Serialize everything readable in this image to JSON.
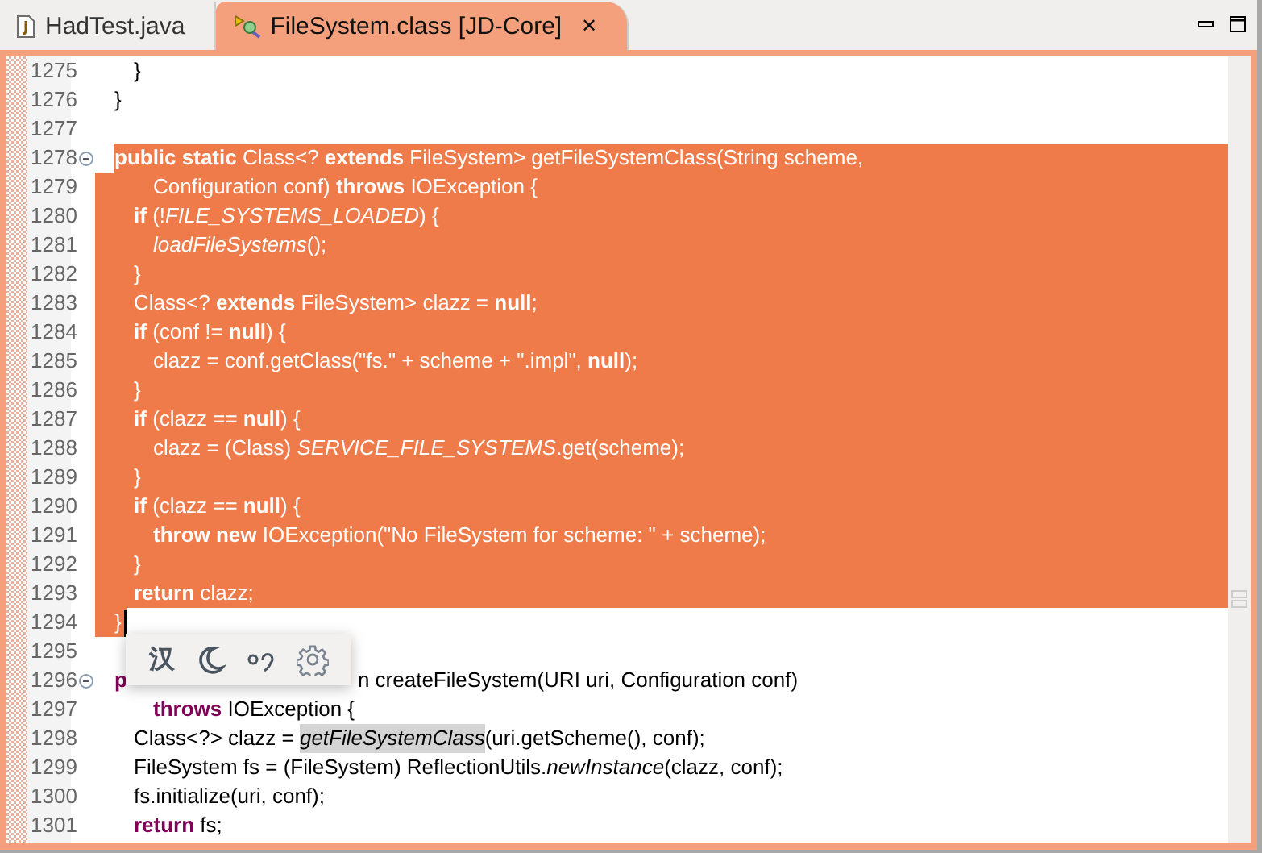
{
  "tabs": [
    {
      "label": "HadTest.java",
      "kind": "java",
      "selected": false
    },
    {
      "label": "FileSystem.class [JD-Core]",
      "kind": "class",
      "selected": true,
      "close": "✕"
    }
  ],
  "editor": {
    "lines": [
      {
        "number": "1275",
        "selected": false,
        "tokens": [
          {
            "text": "\t}",
            "kind": "plain"
          }
        ]
      },
      {
        "number": "1276",
        "selected": false,
        "tokens": [
          {
            "text": "}",
            "kind": "plain"
          }
        ]
      },
      {
        "number": "1277",
        "selected": false
      },
      {
        "number": "1278",
        "selected": true,
        "fold": true,
        "tokens": [
          {
            "text": "public static",
            "kind": "keyword"
          },
          {
            "text": " Class<? ",
            "kind": "plain"
          },
          {
            "text": "extends",
            "kind": "keyword"
          },
          {
            "text": " FileSystem> getFileSystemClass(String scheme,",
            "kind": "plain"
          }
        ]
      },
      {
        "number": "1279",
        "selected": true,
        "tokens": [
          {
            "text": "\t\tConfiguration conf) ",
            "kind": "plain"
          },
          {
            "text": "throws",
            "kind": "keyword"
          },
          {
            "text": " IOException {",
            "kind": "plain"
          }
        ]
      },
      {
        "number": "1280",
        "selected": true,
        "tokens": [
          {
            "text": "\tif",
            "kind": "keyword"
          },
          {
            "text": " (!",
            "kind": "plain"
          },
          {
            "text": "FILE_SYSTEMS_LOADED",
            "kind": "constant"
          },
          {
            "text": ") {",
            "kind": "plain"
          }
        ]
      },
      {
        "number": "1281",
        "selected": true,
        "tokens": [
          {
            "text": "\t\tloadFileSystems",
            "kind": "italic"
          },
          {
            "text": "();",
            "kind": "plain"
          }
        ]
      },
      {
        "number": "1282",
        "selected": true,
        "tokens": [
          {
            "text": "\t}",
            "kind": "plain"
          }
        ]
      },
      {
        "number": "1283",
        "selected": true,
        "tokens": [
          {
            "text": "\tClass<? ",
            "kind": "plain"
          },
          {
            "text": "extends",
            "kind": "keyword"
          },
          {
            "text": " FileSystem> clazz = ",
            "kind": "plain"
          },
          {
            "text": "null",
            "kind": "keyword"
          },
          {
            "text": ";",
            "kind": "plain"
          }
        ]
      },
      {
        "number": "1284",
        "selected": true,
        "tokens": [
          {
            "text": "\tif",
            "kind": "keyword"
          },
          {
            "text": " (conf != ",
            "kind": "plain"
          },
          {
            "text": "null",
            "kind": "keyword"
          },
          {
            "text": ") {",
            "kind": "plain"
          }
        ]
      },
      {
        "number": "1285",
        "selected": true,
        "tokens": [
          {
            "text": "\t\tclazz = conf.getClass(\"fs.\" + scheme + \".impl\", ",
            "kind": "plain"
          },
          {
            "text": "null",
            "kind": "keyword"
          },
          {
            "text": ");",
            "kind": "plain"
          }
        ]
      },
      {
        "number": "1286",
        "selected": true,
        "tokens": [
          {
            "text": "\t}",
            "kind": "plain"
          }
        ]
      },
      {
        "number": "1287",
        "selected": true,
        "tokens": [
          {
            "text": "\tif",
            "kind": "keyword"
          },
          {
            "text": " (clazz == ",
            "kind": "plain"
          },
          {
            "text": "null",
            "kind": "keyword"
          },
          {
            "text": ") {",
            "kind": "plain"
          }
        ]
      },
      {
        "number": "1288",
        "selected": true,
        "tokens": [
          {
            "text": "\t\tclazz = (Class) ",
            "kind": "plain"
          },
          {
            "text": "SERVICE_FILE_SYSTEMS",
            "kind": "constant"
          },
          {
            "text": ".get(scheme);",
            "kind": "plain"
          }
        ]
      },
      {
        "number": "1289",
        "selected": true,
        "tokens": [
          {
            "text": "\t}",
            "kind": "plain"
          }
        ]
      },
      {
        "number": "1290",
        "selected": true,
        "tokens": [
          {
            "text": "\tif",
            "kind": "keyword"
          },
          {
            "text": " (clazz == ",
            "kind": "plain"
          },
          {
            "text": "null",
            "kind": "keyword"
          },
          {
            "text": ") {",
            "kind": "plain"
          }
        ]
      },
      {
        "number": "1291",
        "selected": true,
        "tokens": [
          {
            "text": "\t\tthrow new",
            "kind": "keyword"
          },
          {
            "text": " IOException(\"No FileSystem for scheme: \" + scheme);",
            "kind": "plain"
          }
        ]
      },
      {
        "number": "1292",
        "selected": true,
        "tokens": [
          {
            "text": "\t}",
            "kind": "plain"
          }
        ]
      },
      {
        "number": "1293",
        "selected": true,
        "tokens": [
          {
            "text": "\treturn",
            "kind": "keyword"
          },
          {
            "text": " clazz;",
            "kind": "plain"
          }
        ]
      },
      {
        "number": "1294",
        "selected": true,
        "cursor": true,
        "tokens": [
          {
            "text": "}",
            "kind": "plain"
          }
        ]
      },
      {
        "number": "1295",
        "selected": false
      },
      {
        "number": "1296",
        "selected": false,
        "fold": true,
        "covered": true,
        "tokens": [
          {
            "text": "p",
            "kind": "keyword"
          },
          {
            "text": "n createFileSystem(URI uri, Configuration conf)",
            "kind": "plain"
          }
        ]
      },
      {
        "number": "1297",
        "selected": false,
        "tokens": [
          {
            "text": "\t\tthrows",
            "kind": "keyword"
          },
          {
            "text": " IOException {",
            "kind": "plain"
          }
        ]
      },
      {
        "number": "1298",
        "selected": false,
        "tokens": [
          {
            "text": "\tClass<?> clazz = ",
            "kind": "plain"
          },
          {
            "text": "getFileSystemClass",
            "kind": "occurrence"
          },
          {
            "text": "(uri.getScheme(), conf);",
            "kind": "plain"
          }
        ]
      },
      {
        "number": "1299",
        "selected": false,
        "tokens": [
          {
            "text": "\tFileSystem fs = (FileSystem) ReflectionUtils.",
            "kind": "plain"
          },
          {
            "text": "newInstance",
            "kind": "italic"
          },
          {
            "text": "(clazz, conf);",
            "kind": "plain"
          }
        ]
      },
      {
        "number": "1300",
        "selected": false,
        "tokens": [
          {
            "text": "\tfs.initialize(uri, conf);",
            "kind": "plain"
          }
        ]
      },
      {
        "number": "1301",
        "selected": false,
        "tokens": [
          {
            "text": "\treturn",
            "kind": "keyword"
          },
          {
            "text": " fs;",
            "kind": "plain"
          }
        ]
      }
    ]
  },
  "popup": {
    "items": [
      {
        "kind": "text",
        "label": "汉"
      },
      {
        "kind": "moon"
      },
      {
        "kind": "swirl"
      },
      {
        "kind": "gear"
      }
    ]
  }
}
